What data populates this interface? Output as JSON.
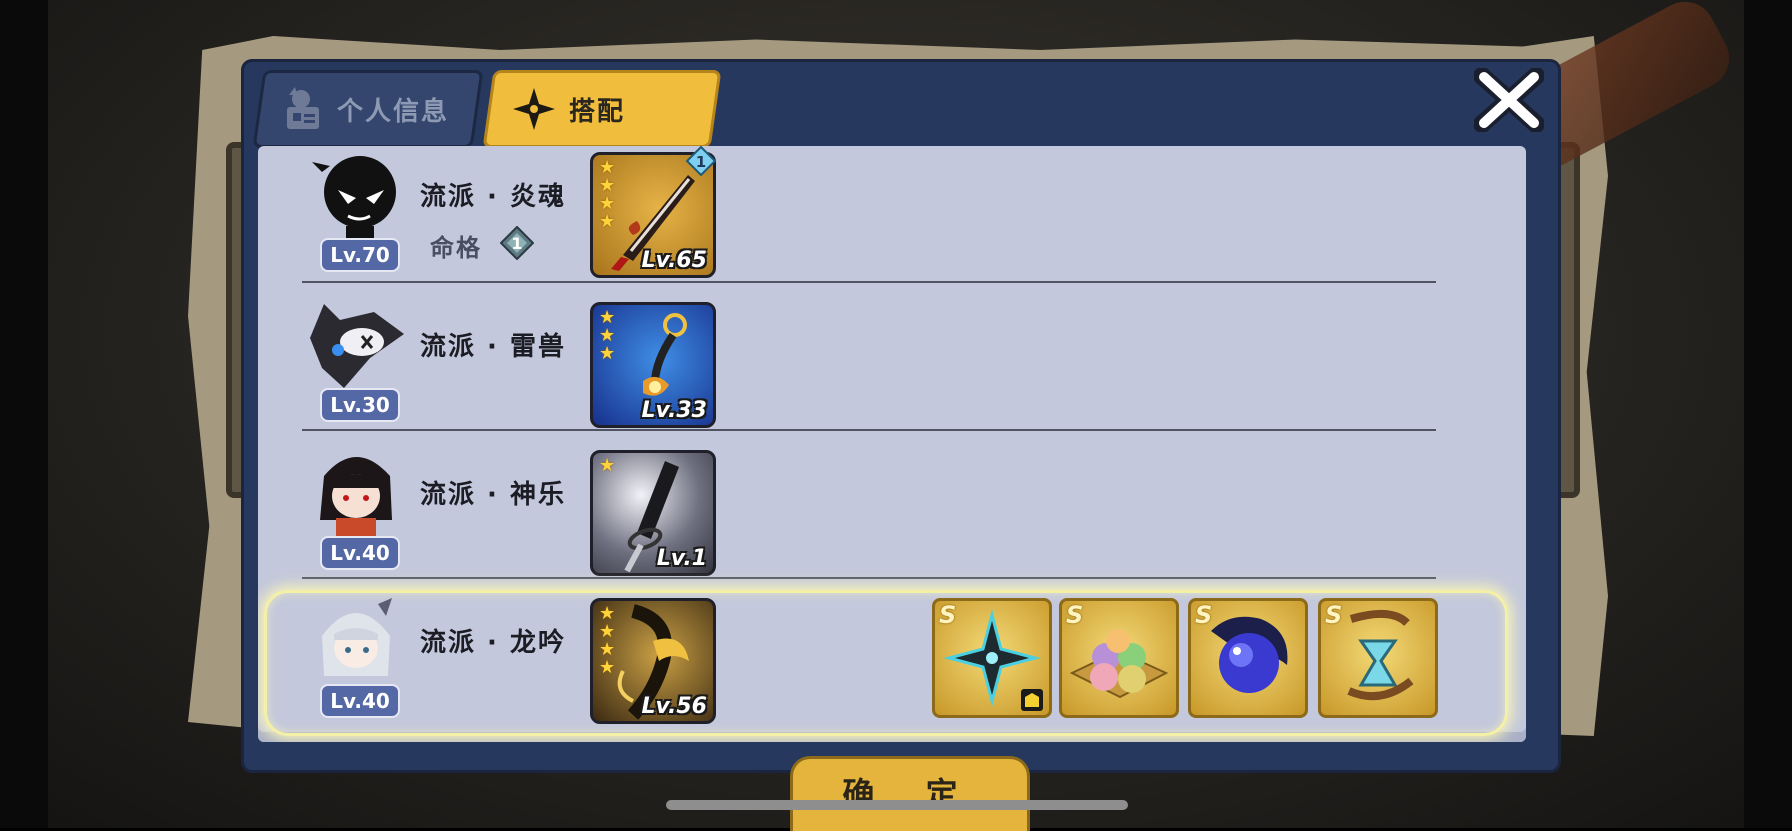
{
  "tabs": [
    {
      "label": "个人信息",
      "active": false,
      "icon": "profile-card-icon"
    },
    {
      "label": "搭配",
      "active": true,
      "icon": "shuriken-icon"
    }
  ],
  "close_icon": "close-icon",
  "rows": [
    {
      "level": "Lv.70",
      "school": "流派 · 炎魂",
      "fate_label": "命格",
      "fate_badge": "1",
      "weapon_stars": 4,
      "weapon_level": "Lv.65",
      "weapon_badge": "1",
      "selected": false
    },
    {
      "level": "Lv.30",
      "school": "流派 · 雷兽",
      "weapon_stars": 3,
      "weapon_level": "Lv.33",
      "selected": false
    },
    {
      "level": "Lv.40",
      "school": "流派 · 神乐",
      "weapon_stars": 1,
      "weapon_level": "Lv.1",
      "selected": false
    },
    {
      "level": "Lv.40",
      "school": "流派 · 龙吟",
      "weapon_stars": 4,
      "weapon_level": "Lv.56",
      "selected": true,
      "equipment": [
        {
          "grade": "S",
          "icon": "shuriken-item-icon"
        },
        {
          "grade": "S",
          "icon": "dango-item-icon"
        },
        {
          "grade": "S",
          "icon": "orb-item-icon"
        },
        {
          "grade": "S",
          "icon": "hourglass-item-icon"
        }
      ]
    }
  ],
  "confirm_label": "确 定",
  "colors": {
    "panel": "#27385f",
    "list": "#c3c8dc",
    "accent": "#f0be3c",
    "level_badge": "#5568a6"
  }
}
